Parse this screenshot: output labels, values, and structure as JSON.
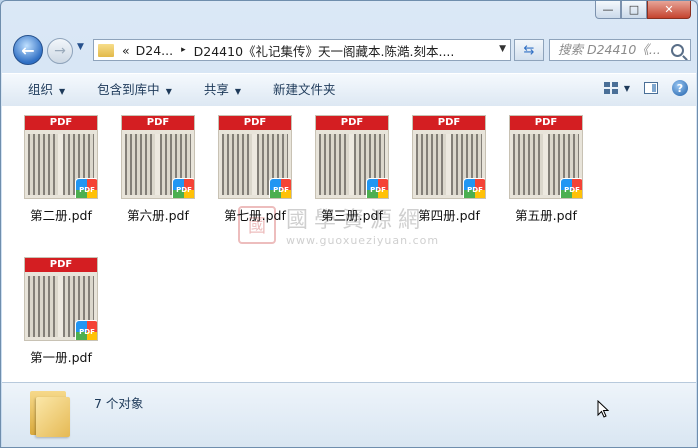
{
  "window": {
    "minimize_label": "—",
    "maximize_label": "□",
    "close_label": "✕"
  },
  "nav": {
    "back_glyph": "←",
    "forward_glyph": "→",
    "history_glyph": "▼",
    "address_prefix": "«",
    "breadcrumb_1": "D24...",
    "sep": "▸",
    "breadcrumb_2": "D24410《礼记集传》天一阁藏本.陈澔.刻本....",
    "refresh_glyph": "⇆",
    "search_placeholder": "搜索 D24410《..."
  },
  "toolbar": {
    "organize": "组织",
    "include_library": "包含到库中",
    "share": "共享",
    "new_folder": "新建文件夹",
    "help": "?"
  },
  "files": [
    {
      "name": "第二册.pdf"
    },
    {
      "name": "第六册.pdf"
    },
    {
      "name": "第七册.pdf"
    },
    {
      "name": "第三册.pdf"
    },
    {
      "name": "第四册.pdf"
    },
    {
      "name": "第五册.pdf"
    },
    {
      "name": "第一册.pdf"
    }
  ],
  "thumb_header": "PDF",
  "badge_text": "PDF",
  "watermark": {
    "seal": "國",
    "cn": "國學資源網",
    "url": "www.guoxueziyuan.com"
  },
  "status": {
    "count_text": "7 个对象"
  }
}
